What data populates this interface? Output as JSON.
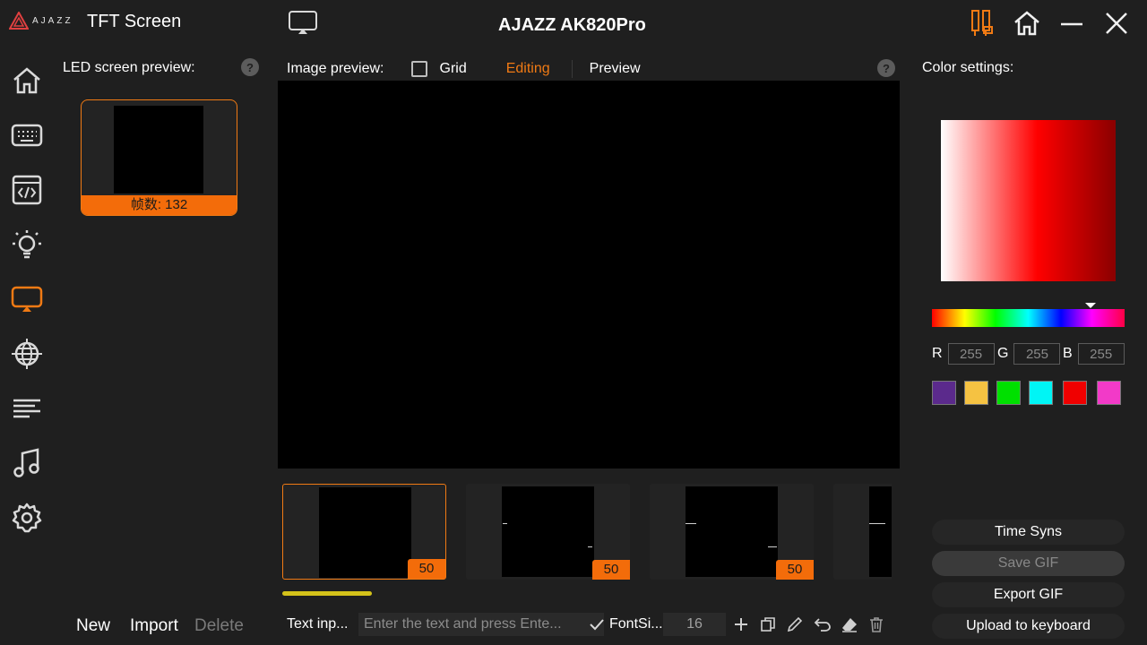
{
  "titlebar": {
    "logo_text": "AJAZZ",
    "app_title": "TFT Screen",
    "device_title": "AJAZZ AK820Pro"
  },
  "sidebar": {
    "items": [
      {
        "name": "home",
        "icon": "home-icon",
        "active": false
      },
      {
        "name": "keyboard",
        "icon": "keyboard-icon",
        "active": false
      },
      {
        "name": "macro",
        "icon": "code-window-icon",
        "active": false
      },
      {
        "name": "lighting",
        "icon": "lightbulb-icon",
        "active": false
      },
      {
        "name": "tft-screen",
        "icon": "screen-cast-icon",
        "active": true
      },
      {
        "name": "network",
        "icon": "globe-icon",
        "active": false
      },
      {
        "name": "list",
        "icon": "lines-icon",
        "active": false
      },
      {
        "name": "music",
        "icon": "music-icon",
        "active": false
      },
      {
        "name": "settings",
        "icon": "gear-icon",
        "active": false
      }
    ]
  },
  "left_panel": {
    "heading": "LED screen preview:",
    "help": "?",
    "frame_count_label": "帧数: 132",
    "actions": {
      "new": "New",
      "import": "Import",
      "delete": "Delete"
    }
  },
  "center": {
    "heading": "Image preview:",
    "grid_label": "Grid",
    "editing_label": "Editing",
    "preview_label": "Preview",
    "help": "?",
    "frames": [
      {
        "duration": "50",
        "active": true
      },
      {
        "duration": "50",
        "active": false
      },
      {
        "duration": "50",
        "active": false
      },
      {
        "duration": "",
        "active": false
      }
    ],
    "text_input_label": "Text inp...",
    "text_input_placeholder": "Enter the text and press Ente...",
    "font_size_label": "FontSi...",
    "font_size_value": "16"
  },
  "right_panel": {
    "heading": "Color settings:",
    "r_label": "R",
    "g_label": "G",
    "b_label": "B",
    "r_value": "255",
    "g_value": "255",
    "b_value": "255",
    "swatches": [
      "#5b2a8c",
      "#f5c242",
      "#00e000",
      "#00f5f5",
      "#f00000",
      "#f23ac8"
    ],
    "buttons": {
      "time_sync": "Time Syns",
      "save_gif": "Save GIF",
      "export_gif": "Export GIF",
      "upload": "Upload to keyboard"
    }
  },
  "colors": {
    "accent": "#f36c0a",
    "background": "#1f1f1f",
    "scroll": "#d4c21a"
  }
}
